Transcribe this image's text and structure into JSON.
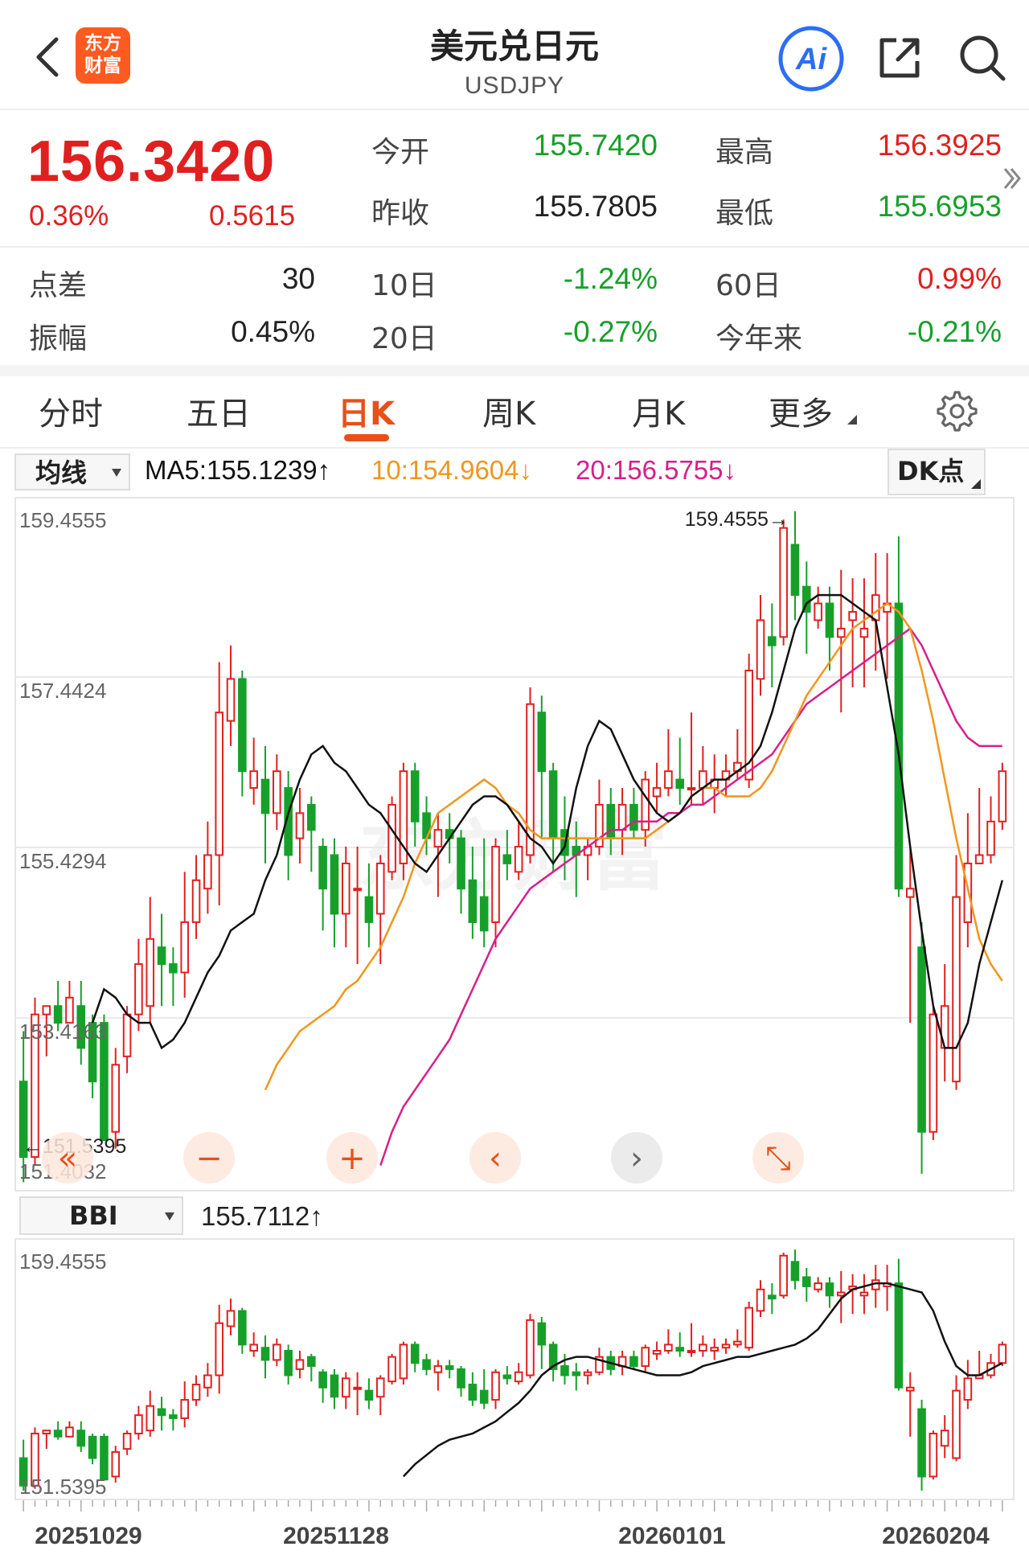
{
  "header": {
    "title": "美元兑日元",
    "subtitle": "USDJPY",
    "logo_line1": "东方",
    "logo_line2": "财富",
    "ai_label": "Ai"
  },
  "quote": {
    "price": "156.3420",
    "change_pct": "0.36%",
    "change": "0.5615",
    "open_label": "今开",
    "open": "155.7420",
    "high_label": "最高",
    "high": "156.3925",
    "prev_close_label": "昨收",
    "prev_close": "155.7805",
    "low_label": "最低",
    "low": "155.6953",
    "spread_label": "点差",
    "spread": "30",
    "d10_label": "10日",
    "d10": "-1.24%",
    "d60_label": "60日",
    "d60": "0.99%",
    "amp_label": "振幅",
    "amp": "0.45%",
    "d20_label": "20日",
    "d20": "-0.27%",
    "ytd_label": "今年来",
    "ytd": "-0.21%"
  },
  "tabs": [
    {
      "label": "分时"
    },
    {
      "label": "五日"
    },
    {
      "label": "日K"
    },
    {
      "label": "周K"
    },
    {
      "label": "月K"
    },
    {
      "label": "更多"
    }
  ],
  "indicator": {
    "ma_dropdown": "均线",
    "ma5": "MA5:155.1239↑",
    "ma10": "10:154.9604↓",
    "ma20": "20:156.5755↓",
    "dk_button": "DK点",
    "bbi_dropdown": "BBI",
    "bbi_value": "155.7112↑"
  },
  "colors": {
    "up": "#e02020",
    "down": "#16a02a",
    "accent": "#e8501a",
    "ma5": "#111111",
    "ma10": "#f0961e",
    "ma20": "#d81e8a"
  },
  "chart_data": [
    {
      "type": "candlestick",
      "ylim": [
        151.4032,
        159.4555
      ],
      "y_ticks": [
        "159.4555",
        "157.4424",
        "155.4294",
        "153.4163",
        "151.4032"
      ],
      "max_marker": "159.4555→",
      "min_marker": "←151.5395",
      "candles": [
        [
          152.6,
          151.7,
          153.2,
          151.4
        ],
        [
          151.7,
          153.4,
          153.6,
          151.6
        ],
        [
          153.4,
          153.5,
          153.5,
          152.9
        ],
        [
          153.5,
          153.3,
          153.8,
          153.2
        ],
        [
          153.3,
          153.6,
          153.8,
          153.3
        ],
        [
          153.5,
          153.0,
          153.8,
          152.8
        ],
        [
          153.3,
          152.6,
          153.4,
          152.4
        ],
        [
          153.3,
          151.9,
          153.4,
          151.9
        ],
        [
          152.0,
          152.8,
          153.0,
          151.8
        ],
        [
          152.9,
          153.4,
          153.5,
          152.7
        ],
        [
          153.4,
          154.0,
          154.3,
          153.2
        ],
        [
          153.5,
          154.3,
          154.8,
          153.3
        ],
        [
          154.2,
          154.0,
          154.6,
          153.5
        ],
        [
          154.0,
          153.9,
          154.2,
          153.5
        ],
        [
          153.9,
          154.5,
          155.1,
          153.6
        ],
        [
          154.5,
          155.0,
          155.3,
          154.3
        ],
        [
          154.9,
          155.3,
          155.7,
          154.6
        ],
        [
          155.3,
          157.0,
          157.6,
          154.7
        ],
        [
          156.9,
          157.4,
          157.8,
          156.6
        ],
        [
          157.4,
          156.3,
          157.5,
          156.0
        ],
        [
          156.1,
          156.3,
          156.7,
          155.9
        ],
        [
          156.2,
          155.8,
          156.6,
          155.2
        ],
        [
          155.8,
          156.3,
          156.5,
          155.6
        ],
        [
          156.1,
          155.3,
          156.3,
          155.0
        ],
        [
          155.5,
          155.8,
          156.1,
          155.2
        ],
        [
          155.9,
          155.6,
          156.0,
          155.1
        ],
        [
          155.4,
          154.9,
          155.5,
          154.4
        ],
        [
          155.3,
          154.6,
          155.5,
          154.2
        ],
        [
          154.6,
          155.2,
          155.4,
          154.2
        ],
        [
          154.9,
          154.9,
          155.4,
          154.0
        ],
        [
          154.8,
          154.5,
          155.2,
          154.2
        ],
        [
          154.6,
          155.2,
          155.3,
          154.0
        ],
        [
          155.1,
          155.9,
          156.0,
          155.0
        ],
        [
          155.2,
          156.3,
          156.4,
          155.0
        ],
        [
          156.3,
          155.7,
          156.4,
          155.4
        ],
        [
          155.8,
          155.5,
          156.0,
          155.3
        ],
        [
          155.4,
          155.6,
          155.8,
          154.8
        ],
        [
          155.6,
          155.5,
          155.8,
          155.2
        ],
        [
          155.5,
          154.9,
          155.6,
          154.6
        ],
        [
          155.0,
          154.5,
          155.4,
          154.3
        ],
        [
          154.8,
          154.4,
          155.5,
          154.2
        ],
        [
          154.5,
          155.4,
          155.5,
          154.2
        ],
        [
          155.3,
          155.2,
          155.6,
          155.0
        ],
        [
          155.1,
          155.4,
          155.7,
          155.0
        ],
        [
          155.3,
          157.1,
          157.3,
          155.2
        ],
        [
          157.0,
          156.3,
          157.2,
          155.5
        ],
        [
          156.3,
          155.5,
          156.4,
          155.1
        ],
        [
          155.6,
          155.3,
          156.0,
          155.0
        ],
        [
          155.4,
          155.3,
          155.7,
          154.8
        ],
        [
          155.3,
          155.4,
          155.5,
          155.0
        ],
        [
          155.4,
          155.9,
          156.2,
          155.3
        ],
        [
          155.9,
          155.5,
          156.1,
          155.3
        ],
        [
          155.6,
          155.9,
          156.1,
          155.3
        ],
        [
          155.9,
          155.6,
          156.1,
          155.5
        ],
        [
          155.6,
          156.2,
          156.3,
          155.4
        ],
        [
          156.0,
          156.1,
          156.4,
          155.8
        ],
        [
          156.1,
          156.3,
          156.8,
          156.0
        ],
        [
          156.2,
          156.1,
          156.7,
          155.9
        ],
        [
          156.1,
          156.1,
          157.0,
          155.9
        ],
        [
          156.1,
          156.3,
          156.6,
          155.9
        ],
        [
          156.1,
          156.2,
          156.5,
          155.8
        ],
        [
          156.2,
          156.3,
          156.5,
          156.0
        ],
        [
          156.3,
          156.4,
          156.8,
          156.2
        ],
        [
          156.2,
          157.5,
          157.7,
          156.1
        ],
        [
          157.4,
          158.1,
          158.4,
          157.2
        ],
        [
          157.9,
          157.8,
          158.3,
          157.3
        ],
        [
          157.9,
          159.2,
          159.3,
          157.8
        ],
        [
          159.0,
          158.4,
          159.4,
          158.1
        ],
        [
          158.5,
          158.2,
          158.8,
          157.7
        ],
        [
          158.1,
          158.3,
          158.5,
          158.0
        ],
        [
          158.3,
          157.9,
          158.5,
          157.5
        ],
        [
          157.9,
          158.0,
          158.7,
          157.0
        ],
        [
          158.1,
          158.2,
          158.6,
          157.3
        ],
        [
          157.9,
          158.0,
          158.6,
          157.3
        ],
        [
          158.1,
          158.4,
          158.9,
          157.5
        ],
        [
          158.2,
          158.3,
          158.9,
          157.4
        ],
        [
          158.3,
          154.9,
          159.1,
          154.8
        ],
        [
          154.8,
          154.9,
          155.4,
          153.3
        ],
        [
          154.2,
          152.0,
          154.5,
          151.5
        ],
        [
          152.0,
          153.4,
          153.5,
          151.9
        ],
        [
          153.0,
          153.5,
          154.0,
          152.6
        ],
        [
          152.6,
          154.8,
          155.3,
          152.5
        ],
        [
          154.5,
          155.2,
          155.8,
          154.2
        ],
        [
          155.2,
          155.3,
          156.1,
          155.2
        ],
        [
          155.3,
          155.7,
          156.0,
          155.2
        ],
        [
          155.7,
          156.3,
          156.4,
          155.6
        ]
      ],
      "ma5": [
        153.3,
        153.7,
        153.6,
        153.4,
        153.3,
        153.3,
        153.0,
        153.1,
        153.3,
        153.6,
        153.9,
        154.1,
        154.4,
        154.5,
        154.6,
        155.0,
        155.3,
        155.8,
        156.2,
        156.5,
        156.6,
        156.4,
        156.3,
        156.1,
        155.9,
        155.8,
        155.6,
        155.4,
        155.2,
        155.1,
        155.3,
        155.5,
        155.7,
        155.9,
        156.0,
        156.0,
        155.9,
        155.7,
        155.5,
        155.4,
        155.2,
        155.4,
        156.1,
        156.6,
        156.9,
        156.8,
        156.5,
        156.2,
        156.0,
        155.8,
        155.7,
        155.8,
        156.0,
        156.1,
        156.2,
        156.2,
        156.3,
        156.4,
        156.6,
        157.0,
        157.5,
        158.0,
        158.3,
        158.4,
        158.4,
        158.4,
        158.3,
        158.2,
        158.1,
        157.3,
        156.5,
        155.4,
        154.4,
        153.5,
        153.0,
        153.0,
        153.3,
        154.0,
        154.5,
        155.0
      ],
      "ma10": [
        152.5,
        152.8,
        153.0,
        153.2,
        153.3,
        153.4,
        153.5,
        153.7,
        153.8,
        154.0,
        154.2,
        154.5,
        154.8,
        155.2,
        155.5,
        155.8,
        155.9,
        156.0,
        156.1,
        156.2,
        156.1,
        155.9,
        155.8,
        155.6,
        155.5,
        155.5,
        155.5,
        155.5,
        155.5,
        155.5,
        155.5,
        155.5,
        155.5,
        155.5,
        155.6,
        155.7,
        155.8,
        156.0,
        156.1,
        156.1,
        156.0,
        156.0,
        156.0,
        156.1,
        156.3,
        156.6,
        156.9,
        157.2,
        157.4,
        157.6,
        157.8,
        158.0,
        158.1,
        158.2,
        158.3,
        158.2,
        158.0,
        157.5,
        156.9,
        156.2,
        155.5,
        154.9,
        154.3,
        154.0,
        153.8
      ],
      "ma20": [
        151.6,
        152.0,
        152.3,
        152.5,
        152.7,
        152.9,
        153.1,
        153.4,
        153.7,
        154.0,
        154.3,
        154.5,
        154.7,
        154.9,
        155.0,
        155.1,
        155.2,
        155.3,
        155.4,
        155.5,
        155.6,
        155.6,
        155.7,
        155.7,
        155.7,
        155.8,
        155.8,
        155.9,
        155.9,
        156.0,
        156.1,
        156.2,
        156.3,
        156.4,
        156.5,
        156.7,
        156.9,
        157.1,
        157.2,
        157.3,
        157.4,
        157.5,
        157.6,
        157.7,
        157.8,
        157.9,
        158.0,
        157.8,
        157.5,
        157.2,
        156.9,
        156.7,
        156.6,
        156.6,
        156.6
      ]
    },
    {
      "type": "candlestick",
      "title": "BBI",
      "y_ticks": [
        "159.4555",
        "151.5395"
      ],
      "x_ticks": [
        "20251029",
        "20251128",
        "20260101",
        "20260204"
      ],
      "bbi": [
        152.0,
        152.4,
        152.7,
        153.0,
        153.2,
        153.3,
        153.4,
        153.6,
        153.8,
        154.1,
        154.4,
        154.8,
        155.3,
        155.6,
        155.8,
        155.9,
        155.9,
        155.8,
        155.7,
        155.6,
        155.5,
        155.4,
        155.3,
        155.3,
        155.3,
        155.4,
        155.6,
        155.7,
        155.8,
        155.9,
        155.9,
        156.0,
        156.1,
        156.2,
        156.3,
        156.5,
        156.8,
        157.3,
        157.8,
        158.1,
        158.2,
        158.3,
        158.3,
        158.2,
        158.1,
        158.0,
        157.4,
        156.4,
        155.6,
        155.3,
        155.3,
        155.5,
        155.7
      ]
    }
  ]
}
